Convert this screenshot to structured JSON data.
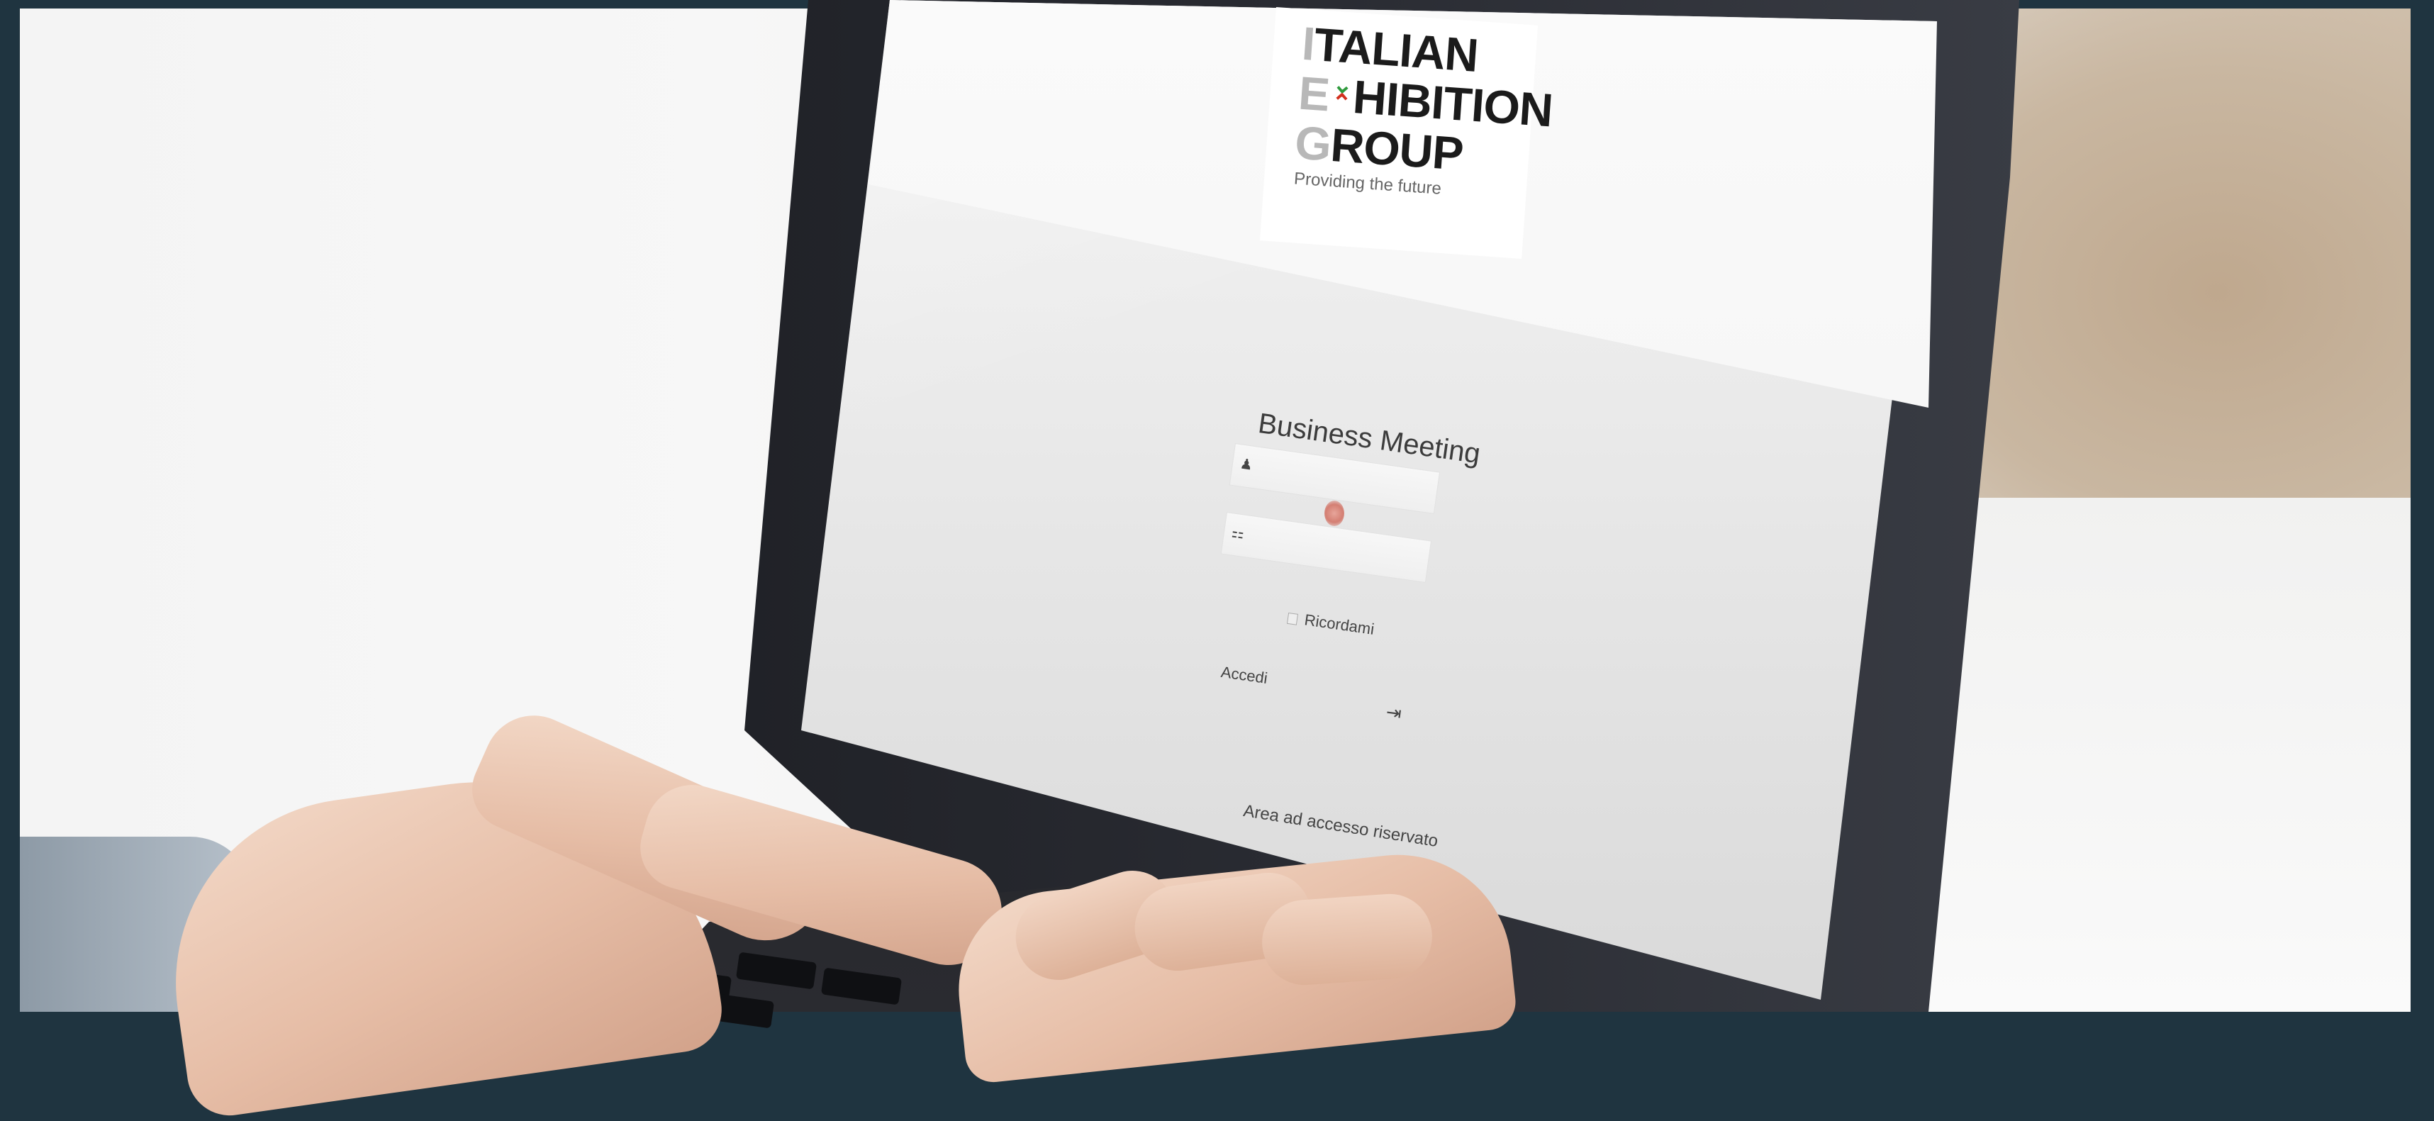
{
  "logo": {
    "line1_first": "I",
    "line1_rest": "TALIAN",
    "line2_first": "E",
    "line2_rest": "HIBITION",
    "line3_first": "G",
    "line3_rest": "ROUP",
    "tagline": "Providing the future"
  },
  "login_form": {
    "title": "Business Meeting",
    "username_icon": "user-icon",
    "password_icon": "lock-icon",
    "remember_label": "Ricordami",
    "login_label": "Accedi",
    "login_icon": "sign-in-icon",
    "footer": "Area ad accesso riservato"
  },
  "colors": {
    "frame": "#1f3440",
    "logo_green": "#2e9a3c",
    "logo_red": "#d2301e"
  }
}
